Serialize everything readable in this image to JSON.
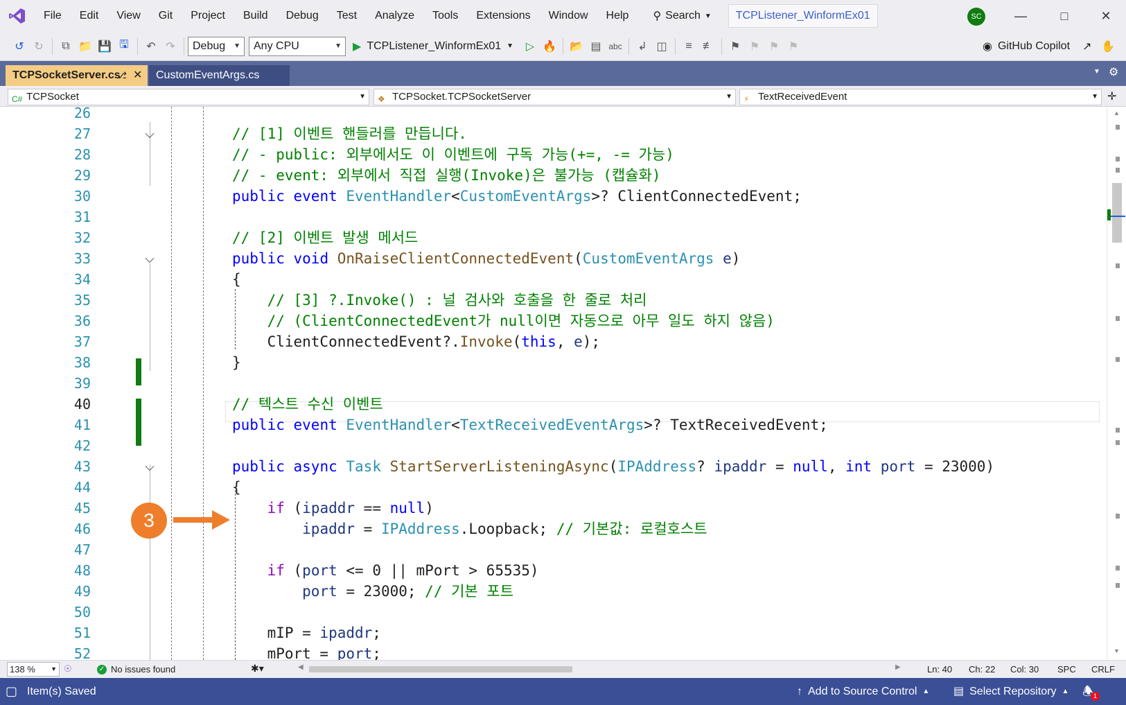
{
  "menu": {
    "items": [
      "File",
      "Edit",
      "View",
      "Git",
      "Project",
      "Build",
      "Debug",
      "Test",
      "Analyze",
      "Tools",
      "Extensions",
      "Window",
      "Help"
    ],
    "search_label": "Search",
    "solution_title": "TCPListener_WinformEx01",
    "avatar_initials": "SC"
  },
  "toolbar": {
    "configuration": "Debug",
    "platform": "Any CPU",
    "run_target": "TCPListener_WinformEx01",
    "copilot_label": "GitHub Copilot"
  },
  "tabs": [
    {
      "label": "TCPSocketServer.cs",
      "active": true
    },
    {
      "label": "CustomEventArgs.cs",
      "active": false
    }
  ],
  "navbar": {
    "project": "TCPSocket",
    "type": "TCPSocket.TCPSocketServer",
    "member": "TextReceivedEvent"
  },
  "editor": {
    "current_line": 40,
    "lines": [
      {
        "n": "26",
        "tokens": []
      },
      {
        "n": "27",
        "tokens": [
          [
            "cmt",
            "// [1] 이벤트 핸들러를 만듭니다."
          ]
        ]
      },
      {
        "n": "28",
        "tokens": [
          [
            "cmt",
            "// - public: 외부에서도 이 이벤트에 구독 가능(+=, -= 가능)"
          ]
        ]
      },
      {
        "n": "29",
        "tokens": [
          [
            "cmt",
            "// - event: 외부에서 직접 실행(Invoke)은 불가능 (캡슐화)"
          ]
        ]
      },
      {
        "n": "30",
        "tokens": [
          [
            "kw",
            "public"
          ],
          [
            "plain",
            " "
          ],
          [
            "kw",
            "event"
          ],
          [
            "plain",
            " "
          ],
          [
            "type",
            "EventHandler"
          ],
          [
            "plain",
            "<"
          ],
          [
            "type",
            "CustomEventArgs"
          ],
          [
            "plain",
            ">? ClientConnectedEvent;"
          ]
        ]
      },
      {
        "n": "31",
        "tokens": []
      },
      {
        "n": "32",
        "tokens": [
          [
            "cmt",
            "// [2] 이벤트 발생 메서드"
          ]
        ]
      },
      {
        "n": "33",
        "tokens": [
          [
            "kw",
            "public"
          ],
          [
            "plain",
            " "
          ],
          [
            "kw",
            "void"
          ],
          [
            "plain",
            " "
          ],
          [
            "fn",
            "OnRaiseClientConnectedEvent"
          ],
          [
            "plain",
            "("
          ],
          [
            "type",
            "CustomEventArgs"
          ],
          [
            "plain",
            " "
          ],
          [
            "var",
            "e"
          ],
          [
            "plain",
            ")"
          ]
        ]
      },
      {
        "n": "34",
        "tokens": [
          [
            "plain",
            "{"
          ]
        ]
      },
      {
        "n": "35",
        "tokens": [
          [
            "plain",
            "    "
          ],
          [
            "cmt",
            "// [3] ?.Invoke() : 널 검사와 호출을 한 줄로 처리"
          ]
        ]
      },
      {
        "n": "36",
        "tokens": [
          [
            "plain",
            "    "
          ],
          [
            "cmt",
            "// (ClientConnectedEvent가 null이면 자동으로 아무 일도 하지 않음)"
          ]
        ]
      },
      {
        "n": "37",
        "tokens": [
          [
            "plain",
            "    ClientConnectedEvent?."
          ],
          [
            "fn",
            "Invoke"
          ],
          [
            "plain",
            "("
          ],
          [
            "kw",
            "this"
          ],
          [
            "plain",
            ", "
          ],
          [
            "var",
            "e"
          ],
          [
            "plain",
            ");"
          ]
        ]
      },
      {
        "n": "38",
        "tokens": [
          [
            "plain",
            "}"
          ]
        ]
      },
      {
        "n": "39",
        "tokens": []
      },
      {
        "n": "40",
        "tokens": [
          [
            "cmt",
            "// 텍스트 수신 이벤트"
          ]
        ]
      },
      {
        "n": "41",
        "tokens": [
          [
            "kw",
            "public"
          ],
          [
            "plain",
            " "
          ],
          [
            "kw",
            "event"
          ],
          [
            "plain",
            " "
          ],
          [
            "type",
            "EventHandler"
          ],
          [
            "plain",
            "<"
          ],
          [
            "type",
            "TextReceivedEventArgs"
          ],
          [
            "plain",
            ">? TextReceivedEvent;"
          ]
        ]
      },
      {
        "n": "42",
        "tokens": []
      },
      {
        "n": "43",
        "tokens": [
          [
            "kw",
            "public"
          ],
          [
            "plain",
            " "
          ],
          [
            "kw",
            "async"
          ],
          [
            "plain",
            " "
          ],
          [
            "type",
            "Task"
          ],
          [
            "plain",
            " "
          ],
          [
            "fn",
            "StartServerListeningAsync"
          ],
          [
            "plain",
            "("
          ],
          [
            "type",
            "IPAddress"
          ],
          [
            "plain",
            "? "
          ],
          [
            "var",
            "ipaddr"
          ],
          [
            "plain",
            " = "
          ],
          [
            "kw",
            "null"
          ],
          [
            "plain",
            ", "
          ],
          [
            "kw",
            "int"
          ],
          [
            "plain",
            " "
          ],
          [
            "var",
            "port"
          ],
          [
            "plain",
            " = 23000)"
          ]
        ]
      },
      {
        "n": "44",
        "tokens": [
          [
            "plain",
            "{"
          ]
        ]
      },
      {
        "n": "45",
        "tokens": [
          [
            "plain",
            "    "
          ],
          [
            "ctl",
            "if"
          ],
          [
            "plain",
            " ("
          ],
          [
            "var",
            "ipaddr"
          ],
          [
            "plain",
            " == "
          ],
          [
            "kw",
            "null"
          ],
          [
            "plain",
            ")"
          ]
        ]
      },
      {
        "n": "46",
        "tokens": [
          [
            "plain",
            "        "
          ],
          [
            "var",
            "ipaddr"
          ],
          [
            "plain",
            " = "
          ],
          [
            "type",
            "IPAddress"
          ],
          [
            "plain",
            ".Loopback; "
          ],
          [
            "cmt",
            "// 기본값: 로컬호스트"
          ]
        ]
      },
      {
        "n": "47",
        "tokens": []
      },
      {
        "n": "48",
        "tokens": [
          [
            "plain",
            "    "
          ],
          [
            "ctl",
            "if"
          ],
          [
            "plain",
            " ("
          ],
          [
            "var",
            "port"
          ],
          [
            "plain",
            " <= 0 || mPort > 65535)"
          ]
        ]
      },
      {
        "n": "49",
        "tokens": [
          [
            "plain",
            "        "
          ],
          [
            "var",
            "port"
          ],
          [
            "plain",
            " = 23000; "
          ],
          [
            "cmt",
            "// 기본 포트"
          ]
        ]
      },
      {
        "n": "50",
        "tokens": []
      },
      {
        "n": "51",
        "tokens": [
          [
            "plain",
            "    mIP = "
          ],
          [
            "var",
            "ipaddr"
          ],
          [
            "plain",
            ";"
          ]
        ]
      },
      {
        "n": "52",
        "tokens": [
          [
            "plain",
            "    mPort = "
          ],
          [
            "var",
            "port"
          ],
          [
            "plain",
            ";"
          ]
        ]
      }
    ],
    "callout_number": "3"
  },
  "editor_status": {
    "zoom": "138 %",
    "issues": "No issues found",
    "ln": "Ln: 40",
    "ch": "Ch: 22",
    "col": "Col: 30",
    "spc": "SPC",
    "eol": "CRLF"
  },
  "statusbar": {
    "message": "Item(s) Saved",
    "source_control": "Add to Source Control",
    "repository": "Select Repository",
    "notification_count": "1"
  },
  "colors": {
    "accent": "#5a6a9a",
    "statusbar": "#3a4f96",
    "active_tab": "#f5cc84",
    "callout": "#ee7e2c",
    "comment": "#008000",
    "keyword": "#0000ff",
    "type": "#2b91af"
  }
}
